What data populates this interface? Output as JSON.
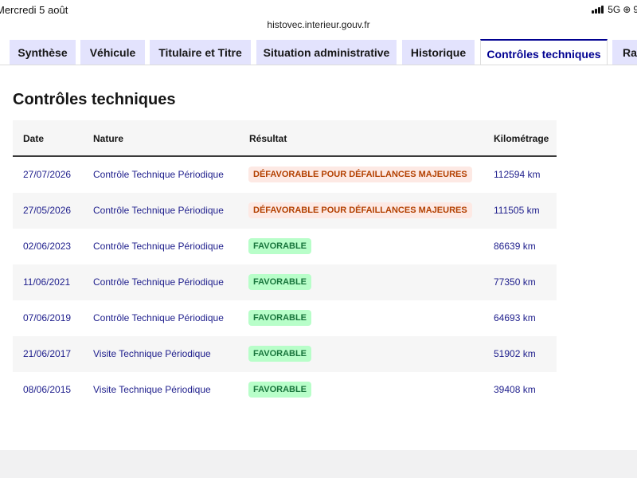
{
  "status_bar": {
    "datetime": "Mercredi 5 août",
    "network": "5G",
    "battery_partial": "9"
  },
  "browser": {
    "url": "histovec.interieur.gouv.fr"
  },
  "tabs": [
    {
      "label": "Synthèse",
      "active": false
    },
    {
      "label": "Véhicule",
      "active": false
    },
    {
      "label": "Titulaire et Titre",
      "active": false
    },
    {
      "label": "Situation administrative",
      "active": false
    },
    {
      "label": "Historique",
      "active": false
    },
    {
      "label": "Contrôles techniques",
      "active": true
    },
    {
      "label": "Rap",
      "active": false
    }
  ],
  "page": {
    "title": "Contrôles techniques"
  },
  "table": {
    "headers": {
      "date": "Date",
      "nature": "Nature",
      "result": "Résultat",
      "km": "Kilométrage"
    },
    "rows": [
      {
        "date": "27/07/2026",
        "nature": "Contrôle Technique Périodique",
        "result": "DÉFAVORABLE POUR DÉFAILLANCES MAJEURES",
        "status": "bad",
        "km": "112594 km"
      },
      {
        "date": "27/05/2026",
        "nature": "Contrôle Technique Périodique",
        "result": "DÉFAVORABLE POUR DÉFAILLANCES MAJEURES",
        "status": "bad",
        "km": "111505 km"
      },
      {
        "date": "02/06/2023",
        "nature": "Contrôle Technique Périodique",
        "result": "FAVORABLE",
        "status": "good",
        "km": "86639 km"
      },
      {
        "date": "11/06/2021",
        "nature": "Contrôle Technique Périodique",
        "result": "FAVORABLE",
        "status": "good",
        "km": "77350 km"
      },
      {
        "date": "07/06/2019",
        "nature": "Contrôle Technique Périodique",
        "result": "FAVORABLE",
        "status": "good",
        "km": "64693 km"
      },
      {
        "date": "21/06/2017",
        "nature": "Visite Technique Périodique",
        "result": "FAVORABLE",
        "status": "good",
        "km": "51902 km"
      },
      {
        "date": "08/06/2015",
        "nature": "Visite Technique Périodique",
        "result": "FAVORABLE",
        "status": "good",
        "km": "39408 km"
      }
    ]
  },
  "colors": {
    "accent": "#000091",
    "tab_bg": "#e3e3fd",
    "bad_bg": "#fde9e4",
    "bad_text": "#b34000",
    "good_bg": "#b8fec9",
    "good_text": "#18753c"
  }
}
